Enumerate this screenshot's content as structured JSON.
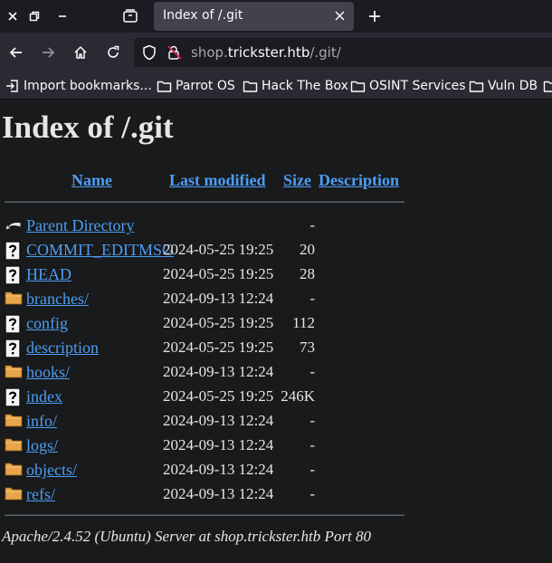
{
  "browser": {
    "tab_title": "Index of /.git",
    "url": {
      "prefix": "shop.",
      "host": "trickster.htb",
      "path": "/.git/"
    },
    "bookmarks": [
      {
        "label": "Import bookmarks...",
        "icon": "import-icon"
      },
      {
        "label": "Parrot OS",
        "icon": "folder-icon"
      },
      {
        "label": "Hack The Box",
        "icon": "folder-icon"
      },
      {
        "label": "OSINT Services",
        "icon": "folder-icon"
      },
      {
        "label": "Vuln DB",
        "icon": "folder-icon"
      }
    ]
  },
  "page": {
    "title": "Index of /.git",
    "columns": {
      "name": "Name",
      "last_modified": "Last modified",
      "size": "Size",
      "description": "Description"
    },
    "rows": [
      {
        "name": "Parent Directory",
        "date": "",
        "size": "-",
        "icon": "back-icon"
      },
      {
        "name": "COMMIT_EDITMSG",
        "date": "2024-05-25 19:25",
        "size": "20",
        "icon": "file-icon"
      },
      {
        "name": "HEAD",
        "date": "2024-05-25 19:25",
        "size": "28",
        "icon": "file-icon"
      },
      {
        "name": "branches/",
        "date": "2024-09-13 12:24",
        "size": "-",
        "icon": "folder-icon"
      },
      {
        "name": "config",
        "date": "2024-05-25 19:25",
        "size": "112",
        "icon": "file-icon"
      },
      {
        "name": "description",
        "date": "2024-05-25 19:25",
        "size": "73",
        "icon": "file-icon"
      },
      {
        "name": "hooks/",
        "date": "2024-09-13 12:24",
        "size": "-",
        "icon": "folder-icon"
      },
      {
        "name": "index",
        "date": "2024-05-25 19:25",
        "size": "246K",
        "icon": "file-icon"
      },
      {
        "name": "info/",
        "date": "2024-09-13 12:24",
        "size": "-",
        "icon": "folder-icon"
      },
      {
        "name": "logs/",
        "date": "2024-09-13 12:24",
        "size": "-",
        "icon": "folder-icon"
      },
      {
        "name": "objects/",
        "date": "2024-09-13 12:24",
        "size": "-",
        "icon": "folder-icon"
      },
      {
        "name": "refs/",
        "date": "2024-09-13 12:24",
        "size": "-",
        "icon": "folder-icon"
      }
    ],
    "footer": "Apache/2.4.52 (Ubuntu) Server at shop.trickster.htb Port 80"
  },
  "colors": {
    "link": "#4f9df5",
    "page_bg": "#181a1b",
    "chrome_bg": "#2b2a33",
    "folder": "#e8a54a"
  }
}
